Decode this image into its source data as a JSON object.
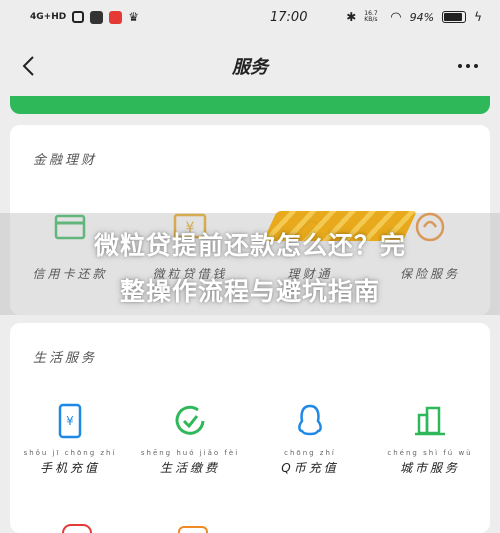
{
  "status_bar": {
    "network": "4G+HD",
    "time": "17:00",
    "signal_small": "16.7\nKB/s",
    "battery_percent": "94%",
    "battery_level": 0.94
  },
  "nav": {
    "title": "服务"
  },
  "finance": {
    "title": "金融理财",
    "items": [
      {
        "label": "信用卡还款",
        "pinyin": "",
        "icon": "credit-card-icon"
      },
      {
        "label": "微粒贷借钱",
        "pinyin": "",
        "icon": "loan-money-icon"
      },
      {
        "label": "理财通",
        "pinyin": "",
        "icon": "wealth-icon"
      },
      {
        "label": "保险服务",
        "pinyin": "",
        "icon": "insurance-icon"
      }
    ]
  },
  "life": {
    "title": "生活服务",
    "items": [
      {
        "label": "手机充值",
        "pinyin": "shǒu jī chōng zhí",
        "icon": "phone-topup-icon"
      },
      {
        "label": "生活缴费",
        "pinyin": "shēng huó jiǎo fèi",
        "icon": "utility-pay-icon"
      },
      {
        "label": "Q币充值",
        "pinyin": "chōng zhí",
        "icon": "qq-coin-icon"
      },
      {
        "label": "城市服务",
        "pinyin": "chéng shì fú wù",
        "icon": "city-service-icon"
      }
    ]
  },
  "overlay": {
    "line1": "微粒贷提前还款怎么还？完",
    "line2": "整操作流程与避坑指南"
  },
  "colors": {
    "green": "#2fb85a",
    "blue": "#1e88e5",
    "gold": "#e8a712"
  }
}
